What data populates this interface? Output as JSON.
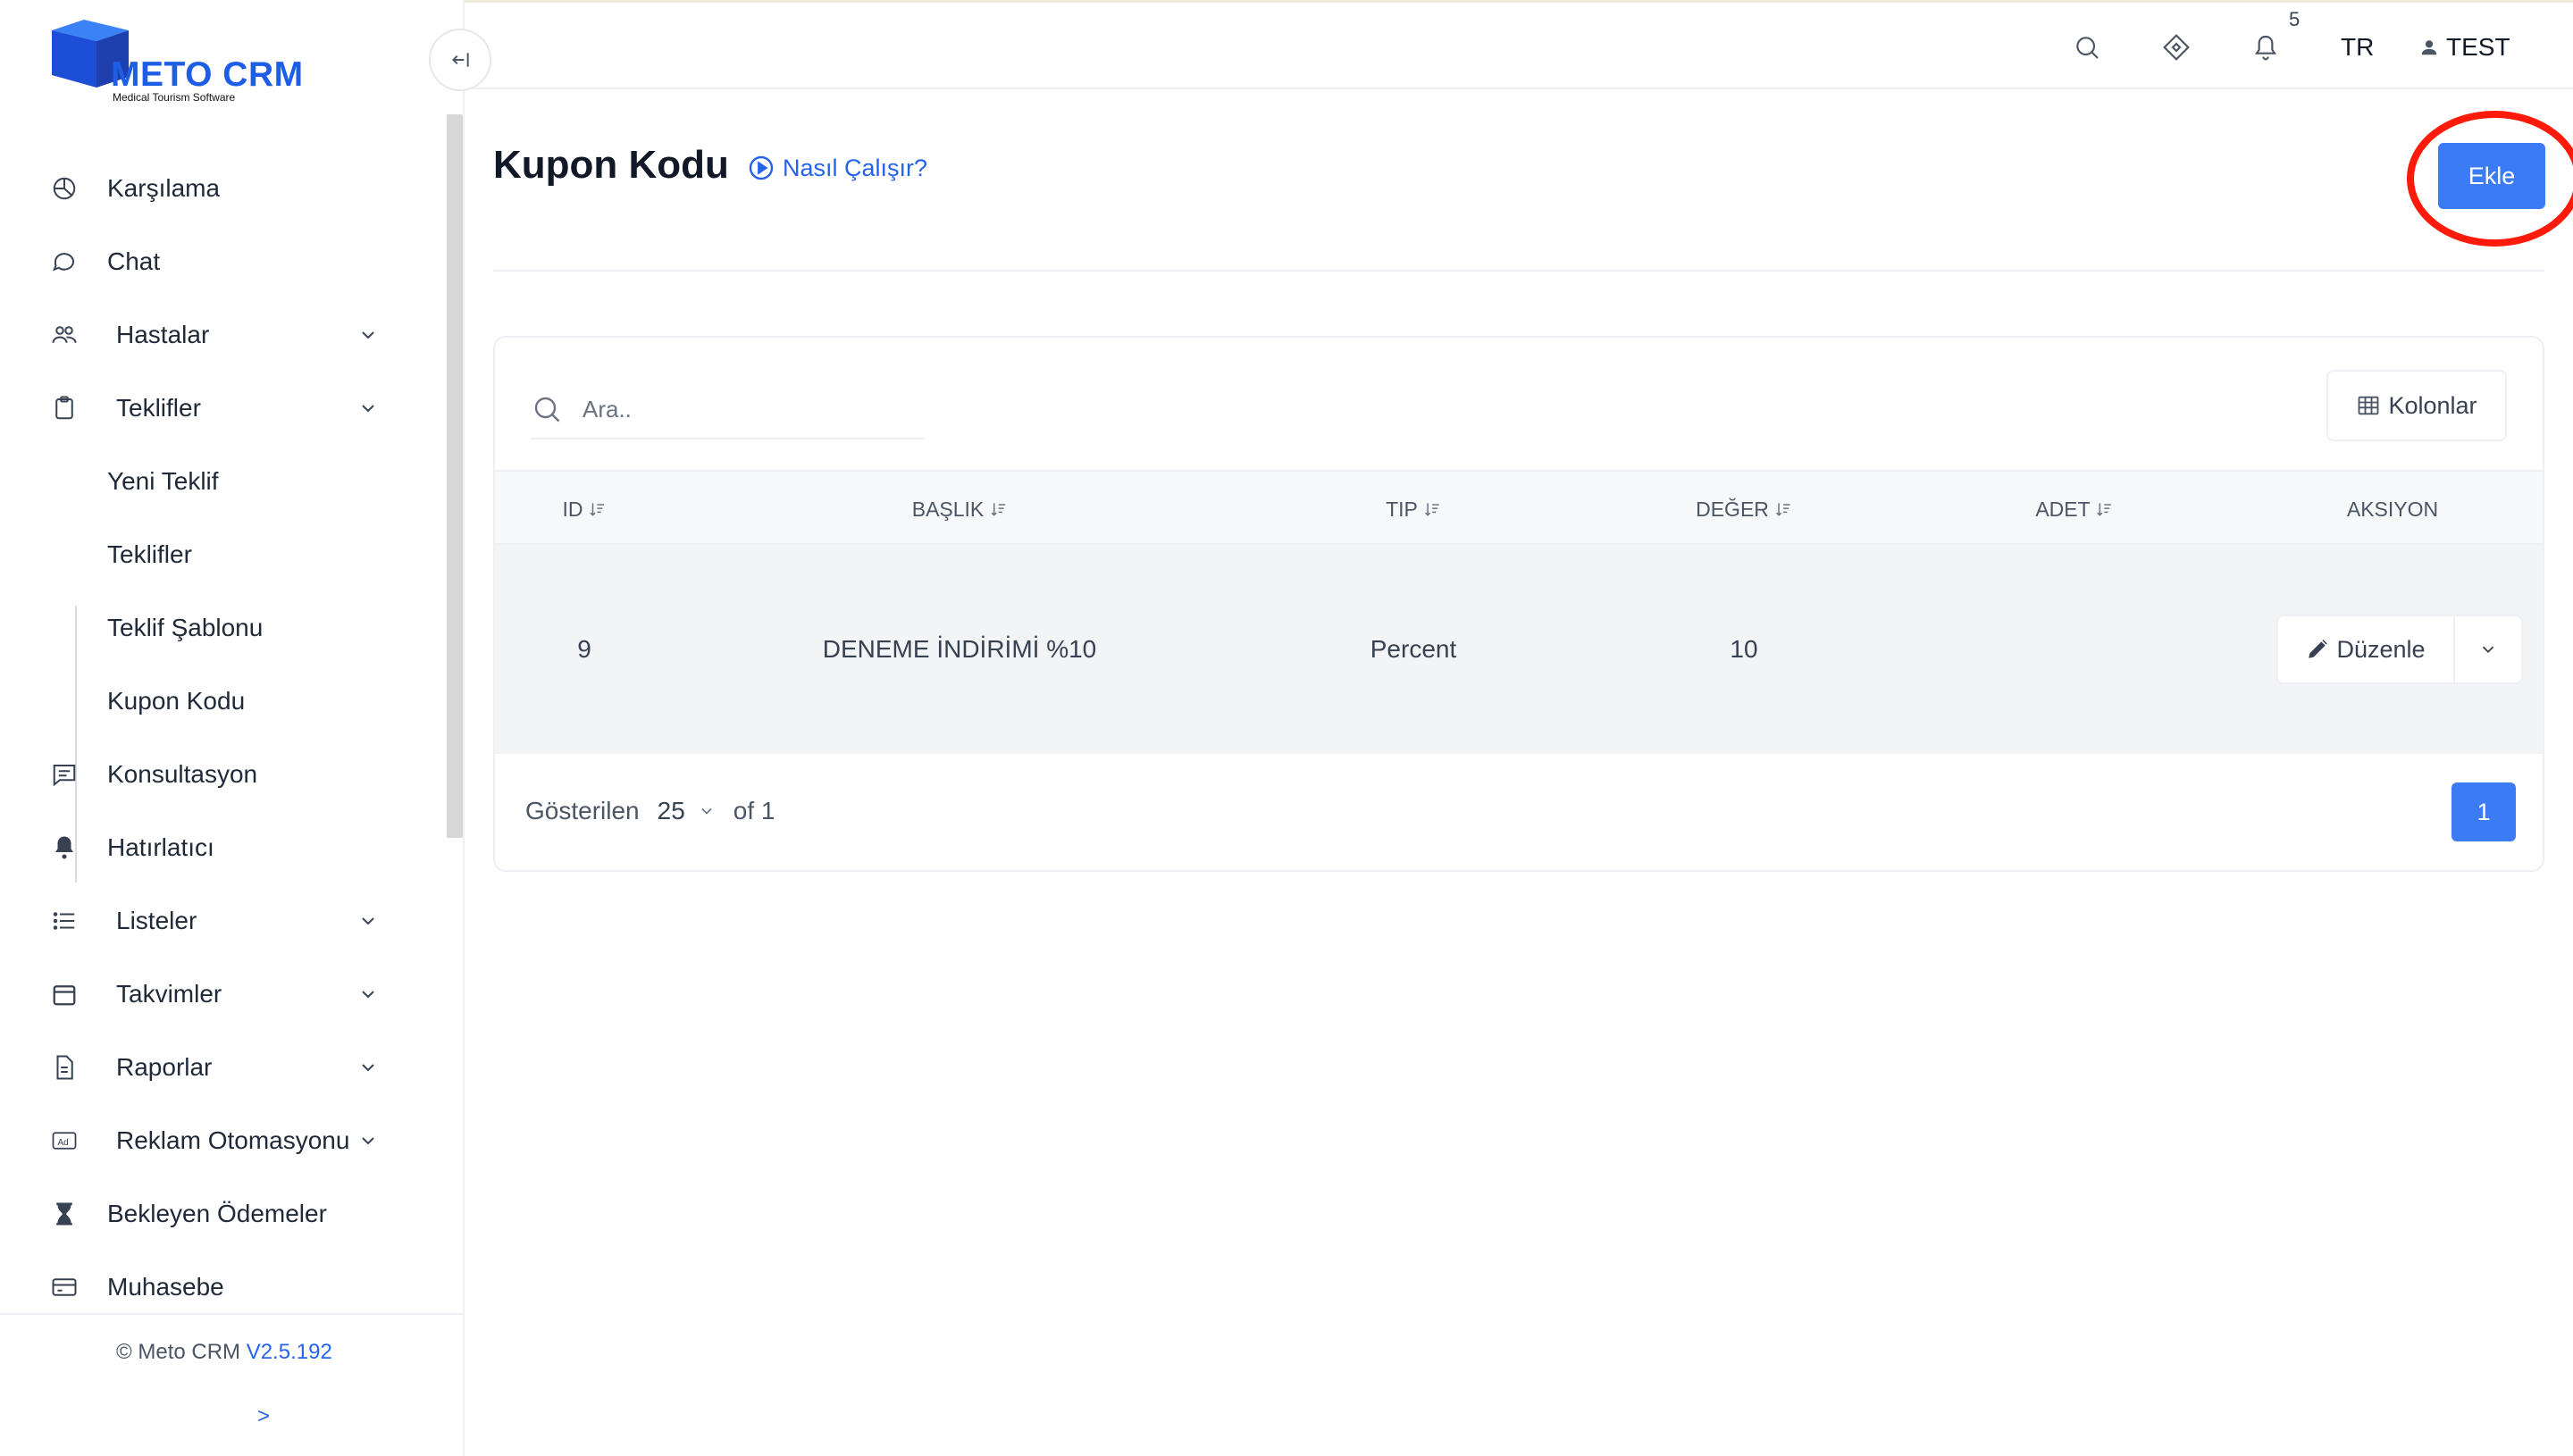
{
  "brand": {
    "name": "METO CRM",
    "tagline": "Medical Tourism Software",
    "color": "#1e5ee6"
  },
  "sidebar": {
    "items": [
      {
        "label": "Karşılama",
        "icon": "pie-chart-icon"
      },
      {
        "label": "Chat",
        "icon": "chat-bubble-icon"
      },
      {
        "label": "Hastalar",
        "icon": "users-icon"
      },
      {
        "label": "Teklifler",
        "icon": "clipboard-icon"
      },
      {
        "label": "Yeni Teklif"
      },
      {
        "label": "Teklifler"
      },
      {
        "label": "Teklif Şablonu"
      },
      {
        "label": "Kupon Kodu"
      },
      {
        "label": "Konsultasyon",
        "icon": "message-square-icon"
      },
      {
        "label": "Hatırlatıcı",
        "icon": "bell-icon"
      },
      {
        "label": "Listeler",
        "icon": "list-icon"
      },
      {
        "label": "Takvimler",
        "icon": "calendar-icon"
      },
      {
        "label": "Raporlar",
        "icon": "file-icon"
      },
      {
        "label": "Reklam Otomasyonu",
        "icon": "ad-icon"
      },
      {
        "label": "Bekleyen Ödemeler",
        "icon": "hourglass-icon"
      },
      {
        "label": "Muhasebe",
        "icon": "credit-card-icon"
      }
    ],
    "footer": {
      "copyright": "© Meto CRM",
      "version": "V2.5.192",
      "expand": ">"
    }
  },
  "topbar": {
    "notification_count": "5",
    "language": "TR",
    "user_name": "TEST"
  },
  "page": {
    "title": "Kupon Kodu",
    "help_link": "Nasıl Çalışır?",
    "add_button": "Ekle",
    "accent": "#3b7cf5",
    "highlight_color": "#ff1a0a"
  },
  "table": {
    "search_placeholder": "Ara..",
    "columns_button": "Kolonlar",
    "headers": {
      "id": "ID",
      "title": "BAŞLIK",
      "type": "TIP",
      "value": "DEĞER",
      "count": "ADET",
      "action": "AKSIYON"
    },
    "rows": [
      {
        "id": "9",
        "title": "DENEME İNDİRİMİ %10",
        "type": "Percent",
        "value": "10",
        "count": "",
        "edit_label": "Düzenle"
      }
    ],
    "pagination": {
      "showing_label": "Gösterilen",
      "page_size": "25",
      "of_label": "of 1",
      "current_page": "1"
    }
  }
}
